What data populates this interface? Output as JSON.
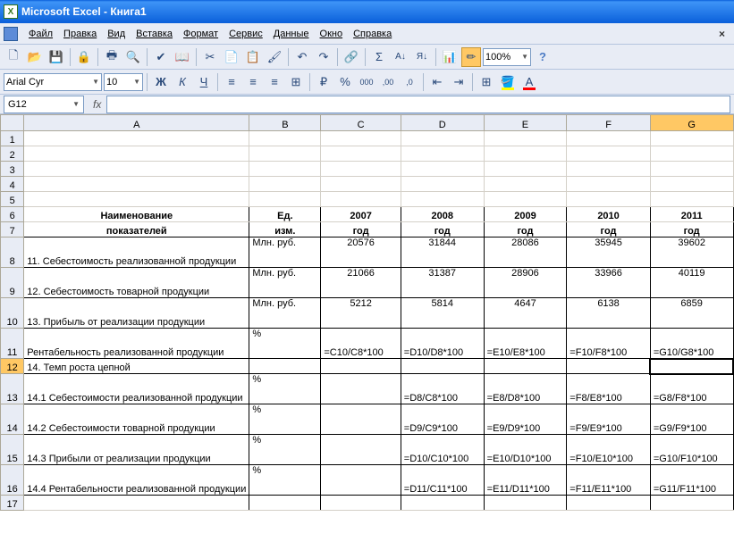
{
  "window": {
    "title": "Microsoft Excel - Книга1"
  },
  "menu": {
    "file": "Файл",
    "edit": "Правка",
    "view": "Вид",
    "insert": "Вставка",
    "format": "Формат",
    "tools": "Сервис",
    "data": "Данные",
    "window": "Окно",
    "help": "Справка"
  },
  "toolbar": {
    "font": "Arial Cyr",
    "size": "10",
    "zoom": "100%"
  },
  "namebox": "G12",
  "formula": "",
  "columns": [
    "A",
    "B",
    "C",
    "D",
    "E",
    "F",
    "G"
  ],
  "header": {
    "r6": {
      "A": "Наименование",
      "B": "Ед.",
      "C": "2007",
      "D": "2008",
      "E": "2009",
      "F": "2010",
      "G": "2011"
    },
    "r7": {
      "A": "показателей",
      "B": "изм.",
      "C": "год",
      "D": "год",
      "E": "год",
      "F": "год",
      "G": "год"
    }
  },
  "rows": {
    "8": {
      "A": "11. Себестоимость реализованной продукции",
      "B": "Млн. руб.",
      "C": "20576",
      "D": "31844",
      "E": "28086",
      "F": "35945",
      "G": "39602"
    },
    "9": {
      "A": "12. Себестоимость товарной продукции",
      "B": "Млн. руб.",
      "C": "21066",
      "D": "31387",
      "E": "28906",
      "F": "33966",
      "G": "40119"
    },
    "10": {
      "A": "13. Прибыль от реализации продукции",
      "B": "Млн. руб.",
      "C": "5212",
      "D": "5814",
      "E": "4647",
      "F": "6138",
      "G": "6859"
    },
    "11": {
      "A": "Рентабельность реализованной продукции",
      "B": "%",
      "C": "=C10/C8*100",
      "D": "=D10/D8*100",
      "E": "=E10/E8*100",
      "F": "=F10/F8*100",
      "G": "=G10/G8*100"
    },
    "12": {
      "A": "14. Темп роста цепной",
      "B": "",
      "C": "",
      "D": "",
      "E": "",
      "F": "",
      "G": ""
    },
    "13": {
      "A": "14.1 Себестоимости реализованной продукции",
      "B": "%",
      "C": "",
      "D": "=D8/C8*100",
      "E": "=E8/D8*100",
      "F": "=F8/E8*100",
      "G": "=G8/F8*100"
    },
    "14": {
      "A": "14.2 Себестоимости товарной продукции",
      "B": "%",
      "C": "",
      "D": "=D9/C9*100",
      "E": "=E9/D9*100",
      "F": "=F9/E9*100",
      "G": "=G9/F9*100"
    },
    "15": {
      "A": "14.3 Прибыли от реализации продукции",
      "B": "%",
      "C": "",
      "D": "=D10/C10*100",
      "E": "=E10/D10*100",
      "F": "=F10/E10*100",
      "G": "=G10/F10*100"
    },
    "16": {
      "A": "14.4 Рентабельности реализованной продукции",
      "B": "%",
      "C": "",
      "D": "=D11/C11*100",
      "E": "=E11/D11*100",
      "F": "=F11/E11*100",
      "G": "=G11/F11*100"
    }
  }
}
